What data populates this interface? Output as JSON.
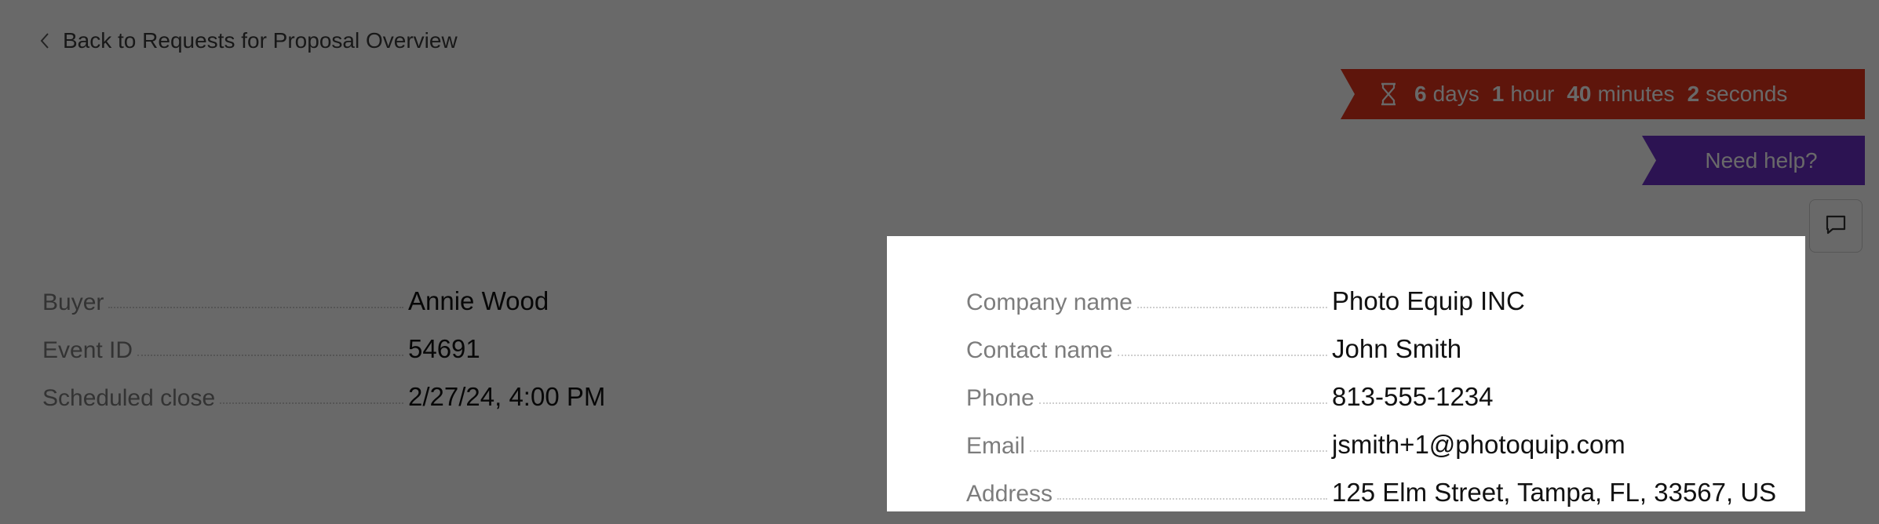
{
  "nav": {
    "back_label": "Back to Requests for Proposal Overview"
  },
  "countdown": {
    "days_num": "6",
    "days_unit": "days",
    "hours_num": "1",
    "hours_unit": "hour",
    "minutes_num": "40",
    "minutes_unit": "minutes",
    "seconds_num": "2",
    "seconds_unit": "seconds",
    "icon": "hourglass-icon",
    "color": "#e4331c"
  },
  "help": {
    "label": "Need help?",
    "color": "#6c2fc7"
  },
  "chat": {
    "icon": "chat-icon"
  },
  "event_details": [
    {
      "label": "Buyer",
      "value": "Annie Wood"
    },
    {
      "label": "Event ID",
      "value": "54691"
    },
    {
      "label": "Scheduled close",
      "value": "2/27/24, 4:00 PM"
    }
  ],
  "contact_details": [
    {
      "label": "Company name",
      "value": "Photo Equip INC"
    },
    {
      "label": "Contact name",
      "value": "John Smith"
    },
    {
      "label": "Phone",
      "value": "813-555-1234"
    },
    {
      "label": "Email",
      "value": "jsmith+1@photoquip.com"
    },
    {
      "label": "Address",
      "value": "125 Elm Street, Tampa, FL, 33567, US"
    }
  ],
  "overlay": {
    "dim_color": "#000000",
    "dim_opacity": 0.59
  }
}
